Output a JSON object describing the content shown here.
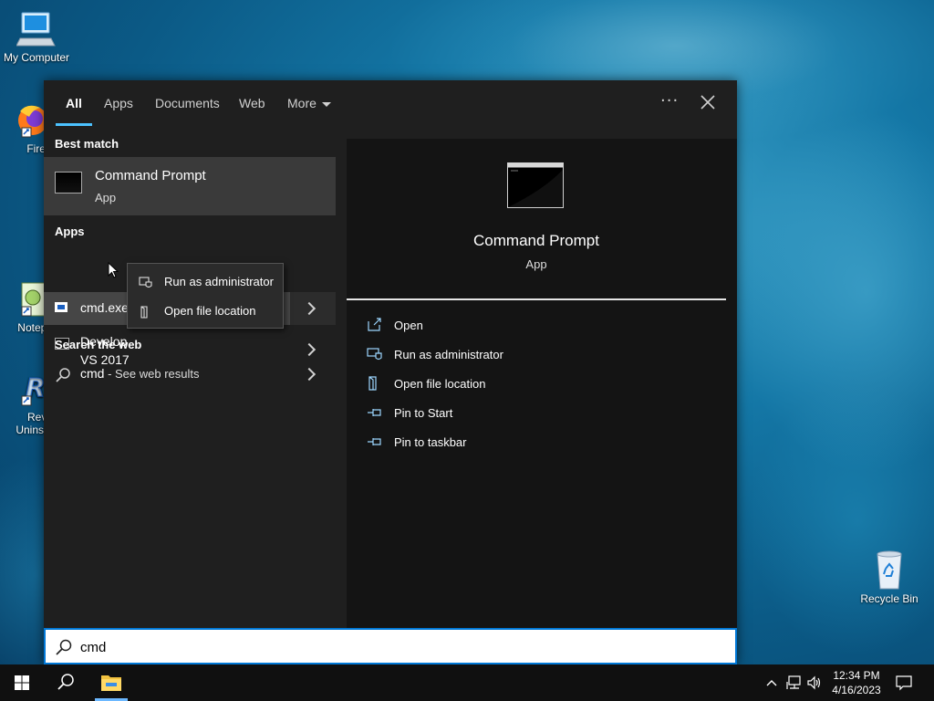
{
  "desktop": {
    "icons": [
      {
        "label": "My Computer"
      },
      {
        "label": "Firefo"
      },
      {
        "label": "Notepa"
      },
      {
        "label": "Reve\nUninsta"
      },
      {
        "label": "Recycle Bin"
      }
    ]
  },
  "start": {
    "tabs": [
      {
        "label": "All"
      },
      {
        "label": "Apps"
      },
      {
        "label": "Documents"
      },
      {
        "label": "Web"
      },
      {
        "label": "More"
      }
    ],
    "sections": {
      "best_match": "Best match",
      "apps": "Apps",
      "search_web": "Search the web"
    },
    "best_match": {
      "title": "Command Prompt",
      "subtitle": "App"
    },
    "apps": [
      {
        "label": "cmd.exe"
      },
      {
        "label_line1": "Develop",
        "label_line2": "VS 2017"
      }
    ],
    "web": {
      "query": "cmd",
      "suffix": " - See web results"
    },
    "context_menu": [
      {
        "label": "Run as administrator"
      },
      {
        "label": "Open file location"
      }
    ],
    "detail": {
      "title": "Command Prompt",
      "subtitle": "App",
      "actions": [
        {
          "label": "Open"
        },
        {
          "label": "Run as administrator"
        },
        {
          "label": "Open file location"
        },
        {
          "label": "Pin to Start"
        },
        {
          "label": "Pin to taskbar"
        }
      ]
    }
  },
  "search": {
    "value": "cmd"
  },
  "taskbar": {
    "time": "12:34 PM",
    "date": "4/16/2023"
  },
  "colors": {
    "accent": "#0078d7",
    "tab_underline": "#4cc2ff"
  }
}
